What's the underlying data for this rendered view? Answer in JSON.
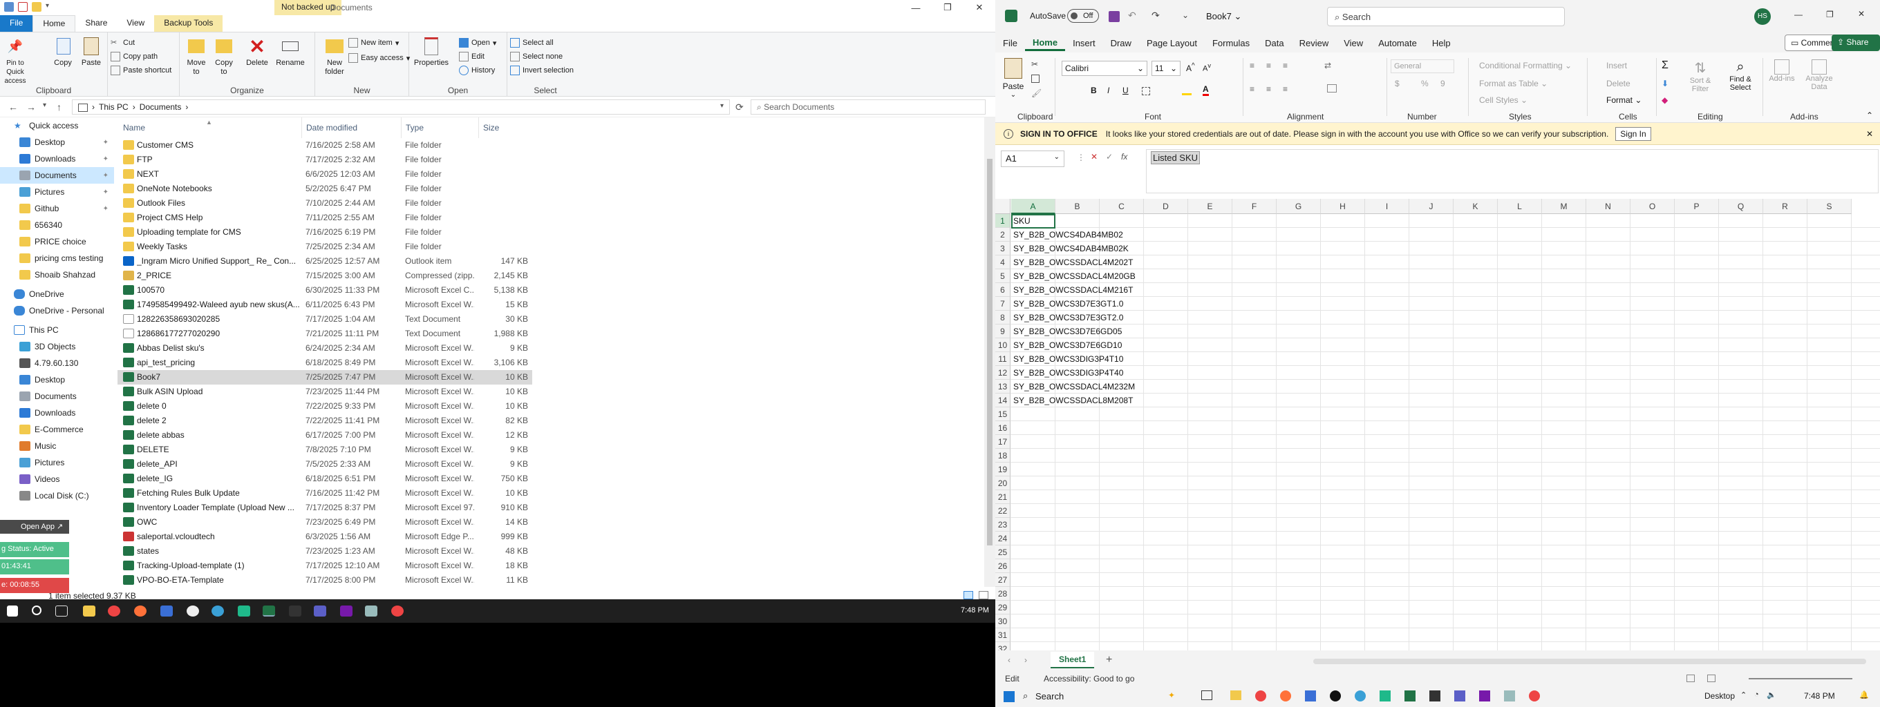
{
  "explorer": {
    "not_backed_up": "Not backed up",
    "window_title": "Documents",
    "tabs": [
      "File",
      "Home",
      "Share",
      "View",
      "Backup Tools"
    ],
    "ribbon": {
      "clipboard": {
        "pin": "Pin to Quick access",
        "copy": "Copy",
        "paste": "Paste",
        "cut": "Cut",
        "copy_path": "Copy path",
        "paste_shortcut": "Paste shortcut",
        "label": "Clipboard"
      },
      "organize": {
        "move_to": "Move to",
        "copy_to": "Copy to",
        "delete": "Delete",
        "rename": "Rename",
        "label": "Organize"
      },
      "new": {
        "new_folder": "New folder",
        "new_item": "New item",
        "easy_access": "Easy access",
        "label": "New"
      },
      "open": {
        "properties": "Properties",
        "open": "Open",
        "edit": "Edit",
        "history": "History",
        "label": "Open"
      },
      "select": {
        "select_all": "Select all",
        "select_none": "Select none",
        "invert": "Invert selection",
        "label": "Select"
      }
    },
    "address": {
      "this_pc": "This PC",
      "sep": "›",
      "documents": "Documents"
    },
    "search_placeholder": "Search Documents",
    "nav": {
      "quick_access": "Quick access",
      "items": [
        {
          "label": "Desktop",
          "pinned": true,
          "color": "#3a86d6"
        },
        {
          "label": "Downloads",
          "pinned": true,
          "color": "#2c7ad6"
        },
        {
          "label": "Documents",
          "pinned": true,
          "color": "#9aa4b0"
        },
        {
          "label": "Pictures",
          "pinned": true,
          "color": "#4aa0d6"
        },
        {
          "label": "Github",
          "pinned": true,
          "color": "#f2c94c"
        },
        {
          "label": "656340",
          "pinned": false,
          "color": "#f2c94c"
        },
        {
          "label": "PRICE choice",
          "pinned": false,
          "color": "#f2c94c"
        },
        {
          "label": "pricing cms testing",
          "pinned": false,
          "color": "#f2c94c"
        },
        {
          "label": "Shoaib Shahzad",
          "pinned": false,
          "color": "#f2c94c"
        }
      ],
      "onedrive": "OneDrive",
      "onedrive_personal": "OneDrive - Personal",
      "this_pc": "This PC",
      "pc_items": [
        "3D Objects",
        "4.79.60.130",
        "Desktop",
        "Documents",
        "Downloads",
        "E-Commerce",
        "Music",
        "Pictures",
        "Videos",
        "Local Disk (C:)"
      ]
    },
    "columns": {
      "name": "Name",
      "date": "Date modified",
      "type": "Type",
      "size": "Size"
    },
    "files": [
      {
        "name": "Customer CMS",
        "date": "7/16/2025 2:58 AM",
        "type": "File folder",
        "size": "",
        "icon": "folder"
      },
      {
        "name": "FTP",
        "date": "7/17/2025 2:32 AM",
        "type": "File folder",
        "size": "",
        "icon": "folder"
      },
      {
        "name": "NEXT",
        "date": "6/6/2025 12:03 AM",
        "type": "File folder",
        "size": "",
        "icon": "folder"
      },
      {
        "name": "OneNote Notebooks",
        "date": "5/2/2025 6:47 PM",
        "type": "File folder",
        "size": "",
        "icon": "folder"
      },
      {
        "name": "Outlook Files",
        "date": "7/10/2025 2:44 AM",
        "type": "File folder",
        "size": "",
        "icon": "folder"
      },
      {
        "name": "Project CMS Help",
        "date": "7/11/2025 2:55 AM",
        "type": "File folder",
        "size": "",
        "icon": "folder"
      },
      {
        "name": "Uploading template for CMS",
        "date": "7/16/2025 6:19 PM",
        "type": "File folder",
        "size": "",
        "icon": "folder"
      },
      {
        "name": "Weekly Tasks",
        "date": "7/25/2025 2:34 AM",
        "type": "File folder",
        "size": "",
        "icon": "folder"
      },
      {
        "name": "_Ingram Micro Unified Support_ Re_ Con...",
        "date": "6/25/2025 12:57 AM",
        "type": "Outlook item",
        "size": "147 KB",
        "icon": "mail"
      },
      {
        "name": "2_PRICE",
        "date": "7/15/2025 3:00 AM",
        "type": "Compressed (zipp...",
        "size": "2,145 KB",
        "icon": "zip"
      },
      {
        "name": "100570",
        "date": "6/30/2025 11:33 PM",
        "type": "Microsoft Excel C...",
        "size": "5,138 KB",
        "icon": "excel"
      },
      {
        "name": "1749585499492-Waleed ayub new skus(A...",
        "date": "6/11/2025 6:43 PM",
        "type": "Microsoft Excel W...",
        "size": "15 KB",
        "icon": "excel"
      },
      {
        "name": "128226358693020285",
        "date": "7/17/2025 1:04 AM",
        "type": "Text Document",
        "size": "30 KB",
        "icon": "text"
      },
      {
        "name": "128686177277020290",
        "date": "7/21/2025 11:11 PM",
        "type": "Text Document",
        "size": "1,988 KB",
        "icon": "text"
      },
      {
        "name": "Abbas Delist sku's",
        "date": "6/24/2025 2:34 AM",
        "type": "Microsoft Excel W...",
        "size": "9 KB",
        "icon": "excel"
      },
      {
        "name": "api_test_pricing",
        "date": "6/18/2025 8:49 PM",
        "type": "Microsoft Excel W...",
        "size": "3,106 KB",
        "icon": "excel"
      },
      {
        "name": "Book7",
        "date": "7/25/2025 7:47 PM",
        "type": "Microsoft Excel W...",
        "size": "10 KB",
        "icon": "excel"
      },
      {
        "name": "Bulk ASIN Upload",
        "date": "7/23/2025 11:44 PM",
        "type": "Microsoft Excel W...",
        "size": "10 KB",
        "icon": "excel"
      },
      {
        "name": "delete 0",
        "date": "7/22/2025 9:33 PM",
        "type": "Microsoft Excel W...",
        "size": "10 KB",
        "icon": "excel"
      },
      {
        "name": "delete 2",
        "date": "7/22/2025 11:41 PM",
        "type": "Microsoft Excel W...",
        "size": "82 KB",
        "icon": "excel"
      },
      {
        "name": "delete abbas",
        "date": "6/17/2025 7:00 PM",
        "type": "Microsoft Excel W...",
        "size": "12 KB",
        "icon": "excel"
      },
      {
        "name": "DELETE",
        "date": "7/8/2025 7:10 PM",
        "type": "Microsoft Excel W...",
        "size": "9 KB",
        "icon": "excel"
      },
      {
        "name": "delete_API",
        "date": "7/5/2025 2:33 AM",
        "type": "Microsoft Excel W...",
        "size": "9 KB",
        "icon": "excel"
      },
      {
        "name": "delete_IG",
        "date": "6/18/2025 6:51 PM",
        "type": "Microsoft Excel W...",
        "size": "750 KB",
        "icon": "excel"
      },
      {
        "name": "Fetching Rules Bulk Update",
        "date": "7/16/2025 11:42 PM",
        "type": "Microsoft Excel W...",
        "size": "10 KB",
        "icon": "excel"
      },
      {
        "name": "Inventory Loader Template (Upload New ...",
        "date": "7/17/2025 8:37 PM",
        "type": "Microsoft Excel 97...",
        "size": "910 KB",
        "icon": "excel"
      },
      {
        "name": "OWC",
        "date": "7/23/2025 6:49 PM",
        "type": "Microsoft Excel W...",
        "size": "14 KB",
        "icon": "excel"
      },
      {
        "name": "saleportal.vcloudtech",
        "date": "6/3/2025 1:56 AM",
        "type": "Microsoft Edge P...",
        "size": "999 KB",
        "icon": "pdf"
      },
      {
        "name": "states",
        "date": "7/23/2025 1:23 AM",
        "type": "Microsoft Excel W...",
        "size": "48 KB",
        "icon": "excel"
      },
      {
        "name": "Tracking-Upload-template (1)",
        "date": "7/17/2025 12:10 AM",
        "type": "Microsoft Excel W...",
        "size": "18 KB",
        "icon": "excel"
      },
      {
        "name": "VPO-BO-ETA-Template",
        "date": "7/17/2025 8:00 PM",
        "type": "Microsoft Excel W...",
        "size": "11 KB",
        "icon": "excel"
      }
    ],
    "status": "1 item selected  9.37 KB",
    "widget": {
      "open_app": "Open App ↗",
      "status": "g Status: Active",
      "time1": "01:43:41",
      "time2": "e: 00:08:55"
    }
  },
  "taskbar_left": {
    "time": "7:48 PM"
  },
  "excel": {
    "autosave": "AutoSave",
    "autosave_state": "Off",
    "filename": "Book7 ⌄",
    "search": "Search",
    "avatar": "HS",
    "tabs": [
      "File",
      "Home",
      "Insert",
      "Draw",
      "Page Layout",
      "Formulas",
      "Data",
      "Review",
      "View",
      "Automate",
      "Help"
    ],
    "comments": "Comments",
    "share": "Share",
    "ribbon": {
      "paste": "Paste",
      "clipboard": "Clipboard",
      "font_name": "Calibri",
      "font_size": "11",
      "font": "Font",
      "alignment": "Alignment",
      "number_format": "General",
      "number": "Number",
      "cond_format": "Conditional Formatting ⌄",
      "format_table": "Format as Table ⌄",
      "cell_styles": "Cell Styles ⌄",
      "styles": "Styles",
      "insert": "Insert",
      "delete": "Delete",
      "format": "Format ⌄",
      "cells": "Cells",
      "sort_filter": "Sort & Filter",
      "find_select": "Find & Select",
      "editing": "Editing",
      "addins": "Add-ins",
      "analyze": "Analyze Data"
    },
    "notice": {
      "title": "SIGN IN TO OFFICE",
      "text": "It looks like your stored credentials are out of date. Please sign in with the account you use with Office so we can verify your subscription.",
      "button": "Sign In"
    },
    "namebox": "A1",
    "fx": "fx",
    "formula_value": "Listed SKU",
    "columns": [
      "A",
      "B",
      "C",
      "D",
      "E",
      "F",
      "G",
      "H",
      "I",
      "J",
      "K",
      "L",
      "M",
      "N",
      "O",
      "P",
      "Q",
      "R",
      "S"
    ],
    "rows": [
      "1",
      "2",
      "3",
      "4",
      "5",
      "6",
      "7",
      "8",
      "9",
      "10",
      "11",
      "12",
      "13",
      "14",
      "15",
      "16",
      "17",
      "18",
      "19",
      "20",
      "21",
      "22",
      "23",
      "24",
      "25",
      "26",
      "27",
      "28",
      "29",
      "30",
      "31",
      "32"
    ],
    "cells": [
      "SKU",
      "SY_B2B_OWCS4DAB4MB02",
      "SY_B2B_OWCS4DAB4MB02K",
      "SY_B2B_OWCSSDACL4M202T",
      "SY_B2B_OWCSSDACL4M20GB",
      "SY_B2B_OWCSSDACL4M216T",
      "SY_B2B_OWCS3D7E3GT1.0",
      "SY_B2B_OWCS3D7E3GT2.0",
      "SY_B2B_OWCS3D7E6GD05",
      "SY_B2B_OWCS3D7E6GD10",
      "SY_B2B_OWCS3DIG3P4T10",
      "SY_B2B_OWCS3DIG3P4T40",
      "SY_B2B_OWCSSDACL4M232M",
      "SY_B2B_OWCSSDACL8M208T"
    ],
    "sheet": "Sheet1",
    "status_mode": "Edit",
    "accessibility": "Accessibility: Good to go",
    "task_search": "Search",
    "desktop": "Desktop",
    "time": "7:48 PM",
    "accent": "#217346"
  }
}
